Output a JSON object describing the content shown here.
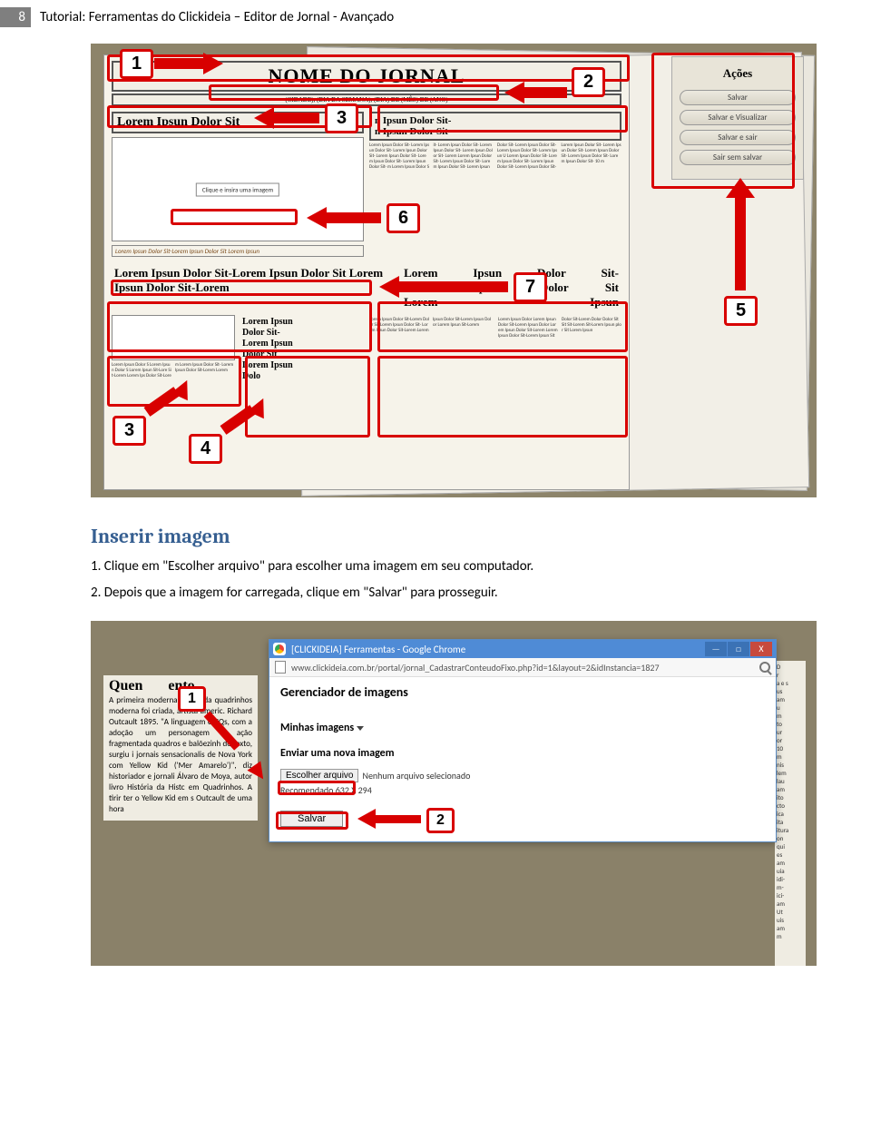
{
  "header": {
    "page_number": "8",
    "title": "Tutorial: Ferramentas do Clickideia – Editor de Jornal - Avançado"
  },
  "figure1": {
    "newspaper": {
      "title": "NOME DO JORNAL",
      "subtitle": "(CIDADE), (DIA DA SEMANA), (DIA) DE (MÊS) DE (ANO)",
      "headline_left": "Lorem Ipsun Dolor Sit",
      "headline_right": "n Ipsun Dolor Sit-\nn Ipsun Dolor Sit",
      "imagebox_label": "Clique e insira uma imagem",
      "caption": "Lorem Ipsun Dolor Sit-Lorem Ipsun Dolor Sit Lorem Ipsun",
      "secondary_left": "Lorem Ipsun Dolor Sit-Lorem Ipsun Dolor Sit Lorem Ipsun Dolor Sit-Lorem",
      "secondary_right": "Lorem Ipsun Dolor Sit-\nLorem Ipsun Dolor Sit\nLorem Ipsun",
      "small_col": "Lorem Ipsun\nDolor Sit-\nLorem Ipsun\nDolor Sit\nLorem Ipsun\nDolo"
    },
    "sidepanel": {
      "title": "Ações",
      "buttons": [
        "Salvar",
        "Salvar e Visualizar",
        "Salvar e sair",
        "Sair sem salvar"
      ]
    },
    "callouts": {
      "c1": "1",
      "c2": "2",
      "c3": "3",
      "c3b": "3",
      "c4": "4",
      "c5": "5",
      "c6": "6",
      "c7": "7"
    }
  },
  "section_heading": "Inserir imagem",
  "body": {
    "line1": "1. Clique em \"Escolher arquivo\" para escolher uma imagem em seu computador.",
    "line2": "2. Depois que a imagem for carregada, clique em \"Salvar\" para prosseguir."
  },
  "figure2": {
    "left_article": {
      "title_left": "Quen",
      "title_right": "ento",
      "body": "A primeira moderna foi criada quadrinhos moderna foi criada, artista americ. Richard Outcault 1895. \"A linguagem c HQs, com a adoção um personagem f ação fragmentada quadros e balõezinh de texto, surgiu i jornais sensacionalis de Nova York com Yellow Kid ('Mer Amarelo')\", diz historiador e jornali Álvaro de Moya, autor livro História da Histc em Quadrinhos. A tirir ter o Yellow Kid em s Outcault de uma hora"
    },
    "right_strip": "D\nr\na e s\nus\nam\nu\nm\nto\nur\nor\n10\nm\nnis\nlem\nlau\nam\nito\ncto\nica\nita\nitura\non\nqui\nes\nam\nuia\nidi-\nm-\nici-\nam\nUt\nuis\nam\nm",
    "chrome": {
      "title": "[CLICKIDEIA] Ferramentas - Google Chrome",
      "url": "www.clickideia.com.br/portal/jornal_CadastrarConteudoFixo.php?id=1&layout=2&idInstancia=1827",
      "heading": "Gerenciador de imagens",
      "sub": "Minhas imagens",
      "upload_label": "Enviar uma nova imagem",
      "choose_btn": "Escolher arquivo",
      "no_file": "Nenhum arquivo selecionado",
      "recommended": "Recomendado 632 X 294",
      "save_btn": "Salvar",
      "win_min": "—",
      "win_max": "□",
      "win_close": "X"
    },
    "callouts": {
      "c1": "1",
      "c2": "2"
    }
  }
}
